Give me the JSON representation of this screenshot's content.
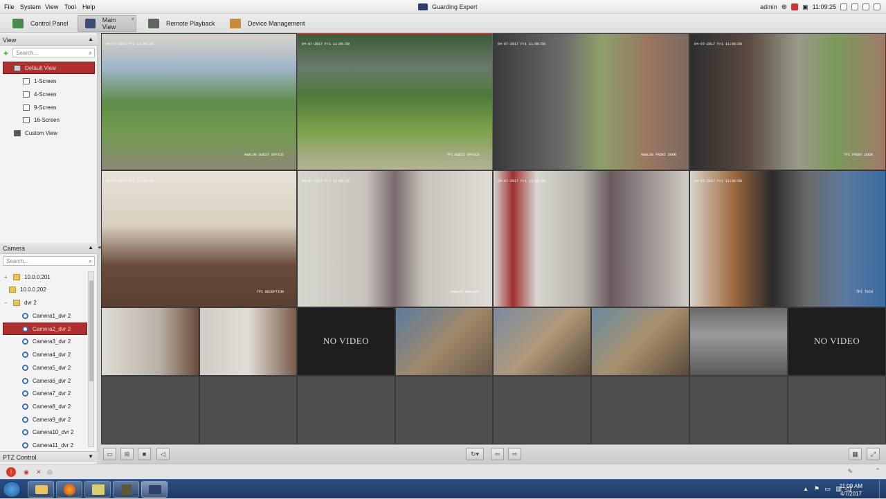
{
  "menu": {
    "items": [
      "File",
      "System",
      "View",
      "Tool",
      "Help"
    ]
  },
  "app_title": "Guarding Expert",
  "status": {
    "user": "admin",
    "time": "11:09:25"
  },
  "tabs": [
    {
      "label": "Control Panel"
    },
    {
      "label": "Main View"
    },
    {
      "label": "Remote Playback"
    },
    {
      "label": "Device Management"
    }
  ],
  "view_panel": {
    "title": "View",
    "search_placeholder": "Search...",
    "items": [
      "Default View",
      "1-Screen",
      "4-Screen",
      "9-Screen",
      "16-Screen",
      "Custom View"
    ]
  },
  "camera_panel": {
    "title": "Camera",
    "search_placeholder": "Search...",
    "items": [
      "10.0.0.201",
      "10.0.0.202",
      "dvr 2",
      "Camera1_dvr 2",
      "Camera2_dvr 2",
      "Camera3_dvr 2",
      "Camera4_dvr 2",
      "Camera5_dvr 2",
      "Camera6_dvr 2",
      "Camera7_dvr 2",
      "Camera8_dvr 2",
      "Camera9_dvr 2",
      "Camera10_dvr 2",
      "Camera11_dvr 2"
    ]
  },
  "ptz": {
    "label": "PTZ Control"
  },
  "video": {
    "timestamp": "04-07-2017 Fri 11:06:50",
    "no_video": "NO VIDEO",
    "large_labels": [
      "ANALOG GUEST OFFICE",
      "TPI GUEST OFFICE",
      "ANALOG FRONT DOOR",
      "TPI FRONT DOOR",
      "TPI RECEPTION",
      "ANALOG HALLWAY",
      "",
      "TPI TECH"
    ]
  },
  "taskbar": {
    "time": "11:09 AM",
    "date": "4/7/2017"
  }
}
